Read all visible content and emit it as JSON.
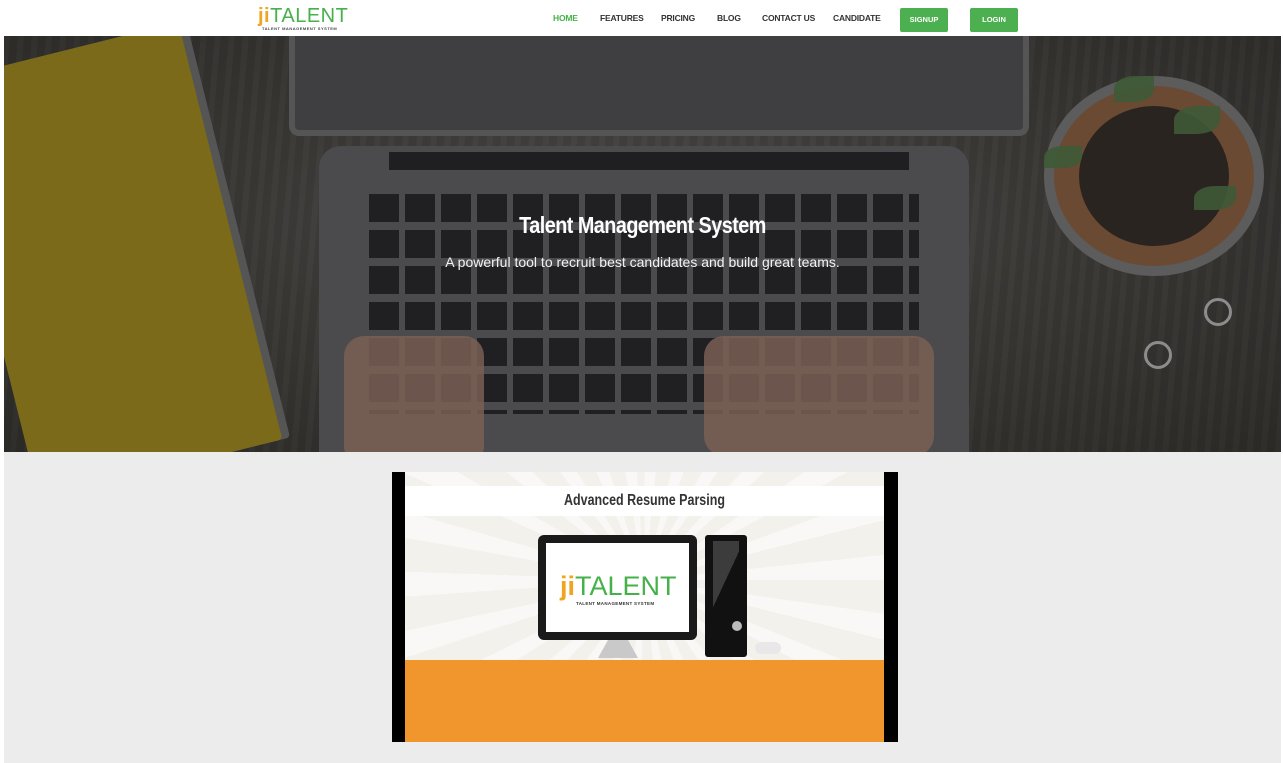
{
  "header": {
    "logo": {
      "ji": "ji",
      "talent": "TALENT",
      "tagline": "TALENT MANAGEMENT SYSTEM"
    },
    "nav": [
      {
        "label": "HOME",
        "active": true
      },
      {
        "label": "FEATURES",
        "active": false
      },
      {
        "label": "PRICING",
        "active": false
      },
      {
        "label": "BLOG",
        "active": false
      },
      {
        "label": "CONTACT US",
        "active": false
      },
      {
        "label": "CANDIDATE",
        "active": false
      }
    ],
    "signup_label": "SIGNUP",
    "login_label": "LOGIN"
  },
  "hero": {
    "title": "Talent Management System",
    "subtitle": "A powerful tool to recruit best candidates and build great teams."
  },
  "video": {
    "title": "Advanced Resume Parsing",
    "screen_logo": {
      "ji": "ji",
      "talent": "TALENT",
      "tagline": "TALENT MANAGEMENT SYSTEM"
    }
  },
  "colors": {
    "brand_green": "#46b04a",
    "button_green": "#4cb050",
    "logo_orange": "#f0a420",
    "band_orange": "#f0962c"
  }
}
